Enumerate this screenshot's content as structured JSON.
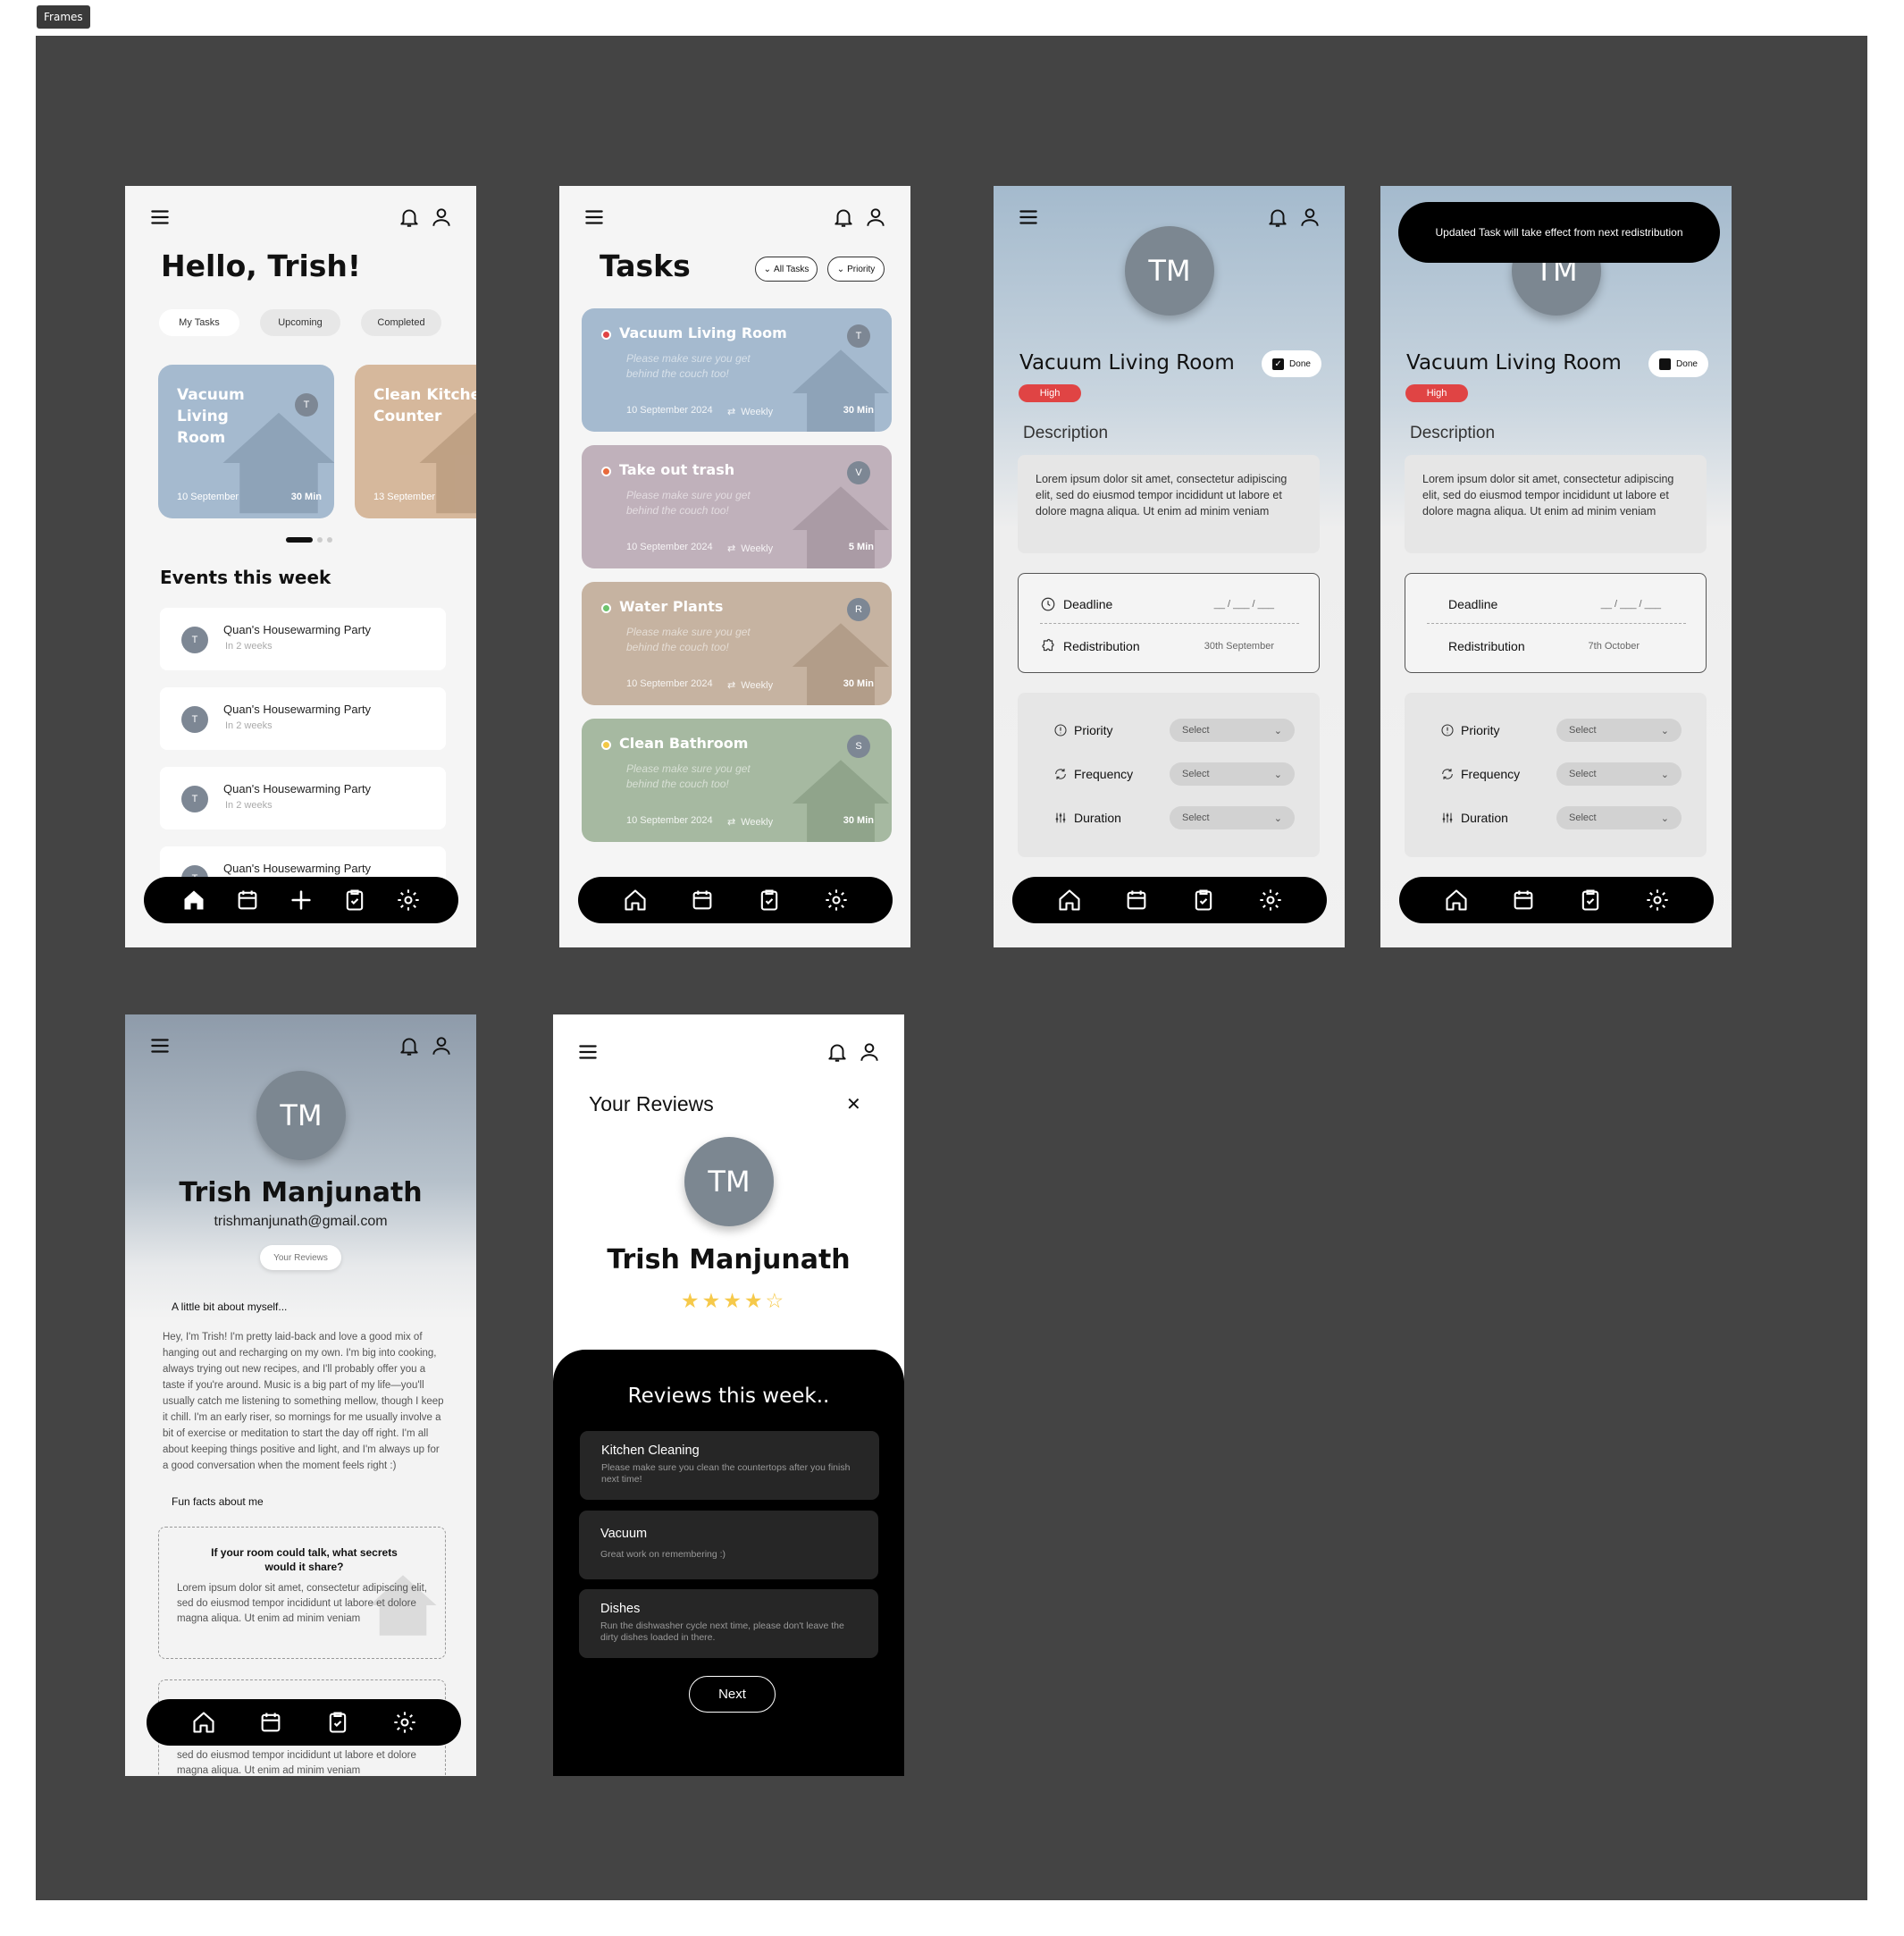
{
  "frames_label": "Frames",
  "home": {
    "greeting": "Hello, Trish!",
    "tabs": [
      "My Tasks",
      "Upcoming",
      "Completed"
    ],
    "cards": [
      {
        "title": "Vacuum Living Room",
        "date": "10 September",
        "duration": "30 Min",
        "assignee": "T",
        "color": "#a5bacf"
      },
      {
        "title": "Clean Kitchen Counter",
        "date": "13 September",
        "duration": "",
        "assignee": "",
        "color": "#d6b89c"
      }
    ],
    "carousel_active": 0,
    "events_heading": "Events this week",
    "events": [
      {
        "name": "Quan's Housewarming Party",
        "when": "In 2 weeks",
        "avatar": "T"
      },
      {
        "name": "Quan's Housewarming Party",
        "when": "In 2 weeks",
        "avatar": "T"
      },
      {
        "name": "Quan's Housewarming Party",
        "when": "In 2 weeks",
        "avatar": "T"
      },
      {
        "name": "Quan's Housewarming Party",
        "when": "",
        "avatar": "T"
      }
    ]
  },
  "tasks": {
    "heading": "Tasks",
    "filters": [
      "All Tasks",
      "Priority"
    ],
    "items": [
      {
        "title": "Vacuum Living Room",
        "desc": "Please make sure you get behind the couch too!",
        "date": "10 September 2024",
        "freq": "Weekly",
        "duration": "30 Min",
        "assignee": "T",
        "color": "#a5bacf",
        "status_color": "#e04444"
      },
      {
        "title": "Take out trash",
        "desc": "Please make sure you get behind the couch too!",
        "date": "10 September 2024",
        "freq": "Weekly",
        "duration": "5 Min",
        "assignee": "V",
        "color": "#c0b1bb",
        "status_color": "#e86a3c"
      },
      {
        "title": "Water Plants",
        "desc": "Please make sure you get behind the couch too!",
        "date": "10 September 2024",
        "freq": "Weekly",
        "duration": "30 Min",
        "assignee": "R",
        "color": "#c6b3a1",
        "status_color": "#6dc36d"
      },
      {
        "title": "Clean Bathroom",
        "desc": "Please make sure you get behind the couch too!",
        "date": "10 September 2024",
        "freq": "Weekly",
        "duration": "30 Min",
        "assignee": "S",
        "color": "#a6b9a1",
        "status_color": "#f3c846"
      }
    ]
  },
  "detail": {
    "initials": "TM",
    "title": "Vacuum Living Room",
    "done_label": "Done",
    "priority_badge": "High",
    "desc_heading": "Description",
    "desc": "Lorem ipsum dolor sit amet, consectetur adipiscing elit, sed do eiusmod tempor incididunt ut labore et dolore magna aliqua. Ut enim ad minim veniam",
    "deadline_label": "Deadline",
    "deadline_value": "__ / ___ / ___",
    "redistribution_label": "Redistribution",
    "redistribution_value": "30th September",
    "selects": [
      {
        "label": "Priority",
        "value": "Select"
      },
      {
        "label": "Frequency",
        "value": "Select"
      },
      {
        "label": "Duration",
        "value": "Select"
      }
    ]
  },
  "detail2": {
    "toast": "Updated Task will take effect from next redistribution",
    "redistribution_value": "7th October"
  },
  "profile": {
    "initials": "TM",
    "name": "Trish Manjunath",
    "email": "trishmanjunath@gmail.com",
    "reviews_button": "Your Reviews",
    "about_heading": "A little bit about myself...",
    "about": "Hey, I'm Trish! I'm pretty laid-back and love a good mix of hanging out and recharging on my own. I'm big into cooking, always trying out new recipes, and I'll probably offer you a taste if you're around. Music is a big part of my life—you'll usually catch me listening to something mellow, though I keep it chill. I'm an early riser, so mornings for me usually involve a bit of exercise or meditation to start the day off right. I'm all about keeping things positive and light, and I'm always up for a good conversation when the moment feels right :)",
    "fun_heading": "Fun facts about me",
    "fun_q": "If your room could talk, what secrets would it share?",
    "fun_a": "Lorem ipsum dolor sit amet, consectetur adipiscing elit, sed do eiusmod tempor incididunt ut labore et dolore magna aliqua. Ut enim ad minim veniam",
    "fun_a2": "sed do eiusmod tempor incididunt ut labore et dolore magna aliqua. Ut enim ad minim veniam"
  },
  "reviews": {
    "heading": "Your Reviews",
    "initials": "TM",
    "name": "Trish Manjunath",
    "rating": 4,
    "rating_max": 5,
    "panel_heading": "Reviews this week..",
    "items": [
      {
        "title": "Kitchen Cleaning",
        "text": "Please make sure you clean the countertops after you finish next time!"
      },
      {
        "title": "Vacuum",
        "text": "Great work on remembering :)"
      },
      {
        "title": "Dishes",
        "text": "Run the dishwasher cycle next time, please don't leave the dirty dishes loaded in there."
      }
    ],
    "next_label": "Next"
  },
  "colors": {
    "canvas": "#444444",
    "screen_bg": "#f5f5f5",
    "accent_red": "#e04444",
    "star": "#f6c94a"
  }
}
